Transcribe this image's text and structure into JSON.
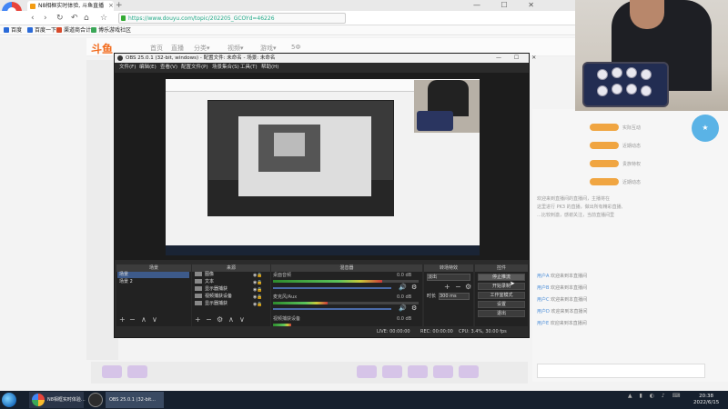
{
  "browser": {
    "logo_label": "拉牌直播",
    "tab_title": "N8相框实时体验, 斗鱼直播",
    "tab_close": "×",
    "tab_new": "+",
    "nav": {
      "back": "‹",
      "forward": "›",
      "reload": "↻",
      "undo": "↶",
      "home": "⌂",
      "star": "☆"
    },
    "url": "https://www.douyu.com/topic/202205_GCOYd=46226",
    "bookmarks": [
      "百度",
      "百度一下",
      "渠道商合计",
      "博乐游戏社区"
    ],
    "window_controls": "— ☐ ✕"
  },
  "site": {
    "logo": "斗鱼",
    "nav": [
      "首页",
      "直播",
      "分类▾",
      "视频▾",
      "游戏▾",
      "5Ф"
    ],
    "right_gifts": [
      "实际互动",
      "近期动态",
      "贵族特权",
      "近期动态",
      "近期动态"
    ],
    "intro": [
      "欢迎来到直播间的直播间，主播将在",
      "这里进行 PK3 的直播，做出所有精彩直播,",
      "…比较刺激，感谢关注，当前直播间里"
    ],
    "chat": [
      {
        "user": "用户A",
        "text": "欢迎来到本直播间"
      },
      {
        "user": "用户B",
        "text": "欢迎来到本直播间"
      },
      {
        "user": "用户C",
        "text": "欢迎来到本直播间"
      },
      {
        "user": "用户D",
        "text": "欢迎来到本直播间"
      },
      {
        "user": "用户E",
        "text": "欢迎来到本直播间"
      }
    ]
  },
  "obs": {
    "title": "OBS 25.0.1 (32-bit, windows) - 配置文件: 未命名 - 场景: 未命名",
    "window_controls": "— ☐ ✕",
    "menu": [
      "文件(F)",
      "编辑(E)",
      "查看(V)",
      "配置文件(P)",
      "场景集合(S)",
      "工具(T)",
      "帮助(H)"
    ],
    "docks": {
      "scenes": "场景",
      "sources": "来源",
      "mixer": "混音器",
      "transitions": "转场特效",
      "controls": "控件"
    },
    "scenes": [
      "场景",
      "场景 2"
    ],
    "sources": [
      "图像",
      "文本",
      "显示器捕获",
      "视频捕获设备",
      "显示器捕获"
    ],
    "mixer": [
      {
        "name": "桌面音频",
        "level": "0.0 dB"
      },
      {
        "name": "麦克风/Aux",
        "level": "0.0 dB"
      },
      {
        "name": "视频捕获设备",
        "level": "0.0 dB"
      }
    ],
    "transition": {
      "type": "淡出",
      "duration_label": "时长",
      "duration": "300 ms"
    },
    "controls": [
      "停止推流",
      "开始录制",
      "工作室模式",
      "设置",
      "退出"
    ],
    "tools": {
      "add": "+",
      "remove": "−",
      "up": "∧",
      "down": "∨",
      "gear": "⚙"
    },
    "status": {
      "live": "LIVE: 00:00:00",
      "rec": "REC: 00:00:00",
      "cpu": "CPU: 3.4%, 30.00 fps"
    }
  },
  "taskbar": {
    "items": [
      "N8相框实时体验...",
      "OBS 25.0.1 (32-bit..."
    ],
    "time": "20:38",
    "date": "2022/6/15"
  }
}
